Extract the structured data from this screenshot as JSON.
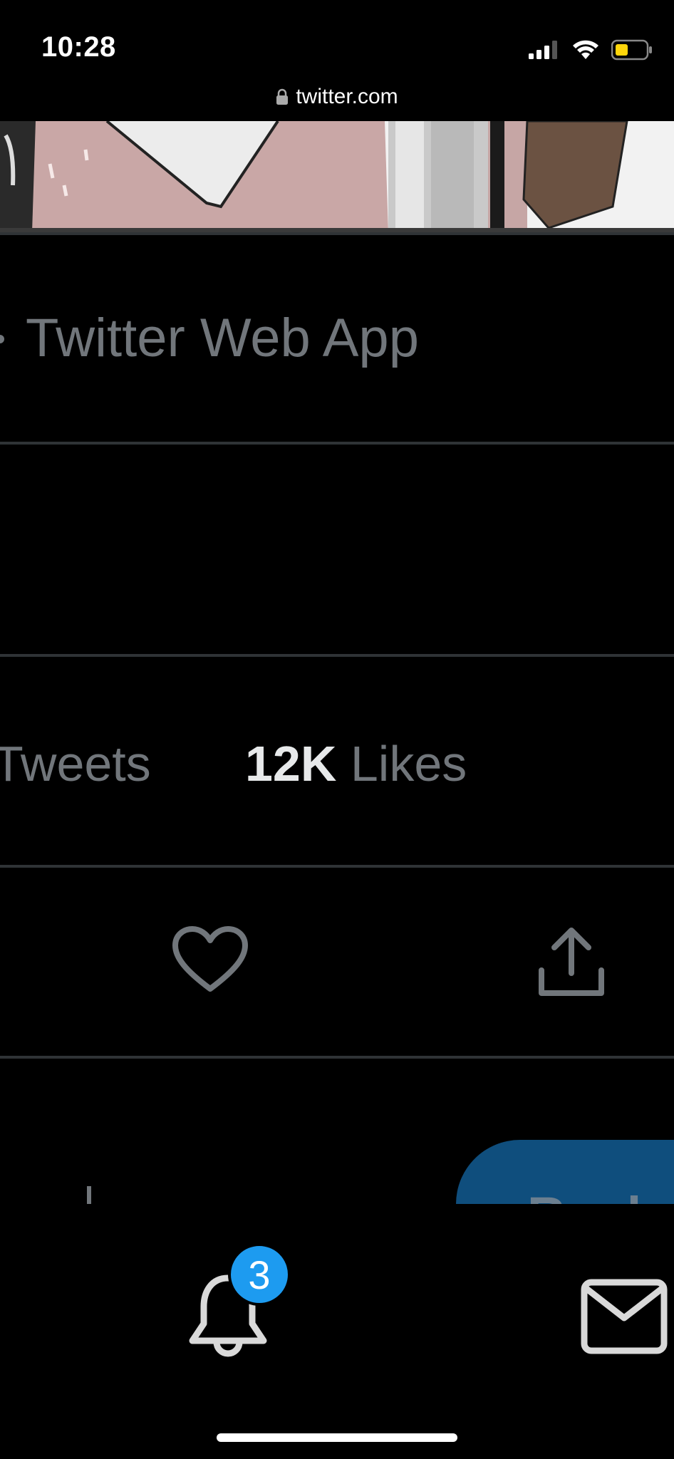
{
  "status_bar": {
    "time": "10:28",
    "signal_icon": "cellular-signal-icon",
    "wifi_icon": "wifi-icon",
    "battery_icon": "battery-icon",
    "battery_color": "#ffd60a"
  },
  "browser": {
    "lock_icon": "lock-icon",
    "url": "twitter.com"
  },
  "tweet": {
    "source": "Twitter Web App",
    "stats": {
      "tweets_label": "Tweets",
      "likes_count": "12K",
      "likes_label": "Likes"
    },
    "actions": {
      "like_icon": "heart-icon",
      "share_icon": "share-icon"
    },
    "reply": {
      "button_label": "Reply"
    }
  },
  "bottom_nav": {
    "notifications_icon": "bell-icon",
    "notifications_badge": "3",
    "messages_icon": "mail-icon"
  },
  "colors": {
    "background": "#000000",
    "muted_text": "#71767b",
    "primary_text": "#e7e9ea",
    "divider": "#2f3336",
    "accent": "#1d9bf0"
  }
}
